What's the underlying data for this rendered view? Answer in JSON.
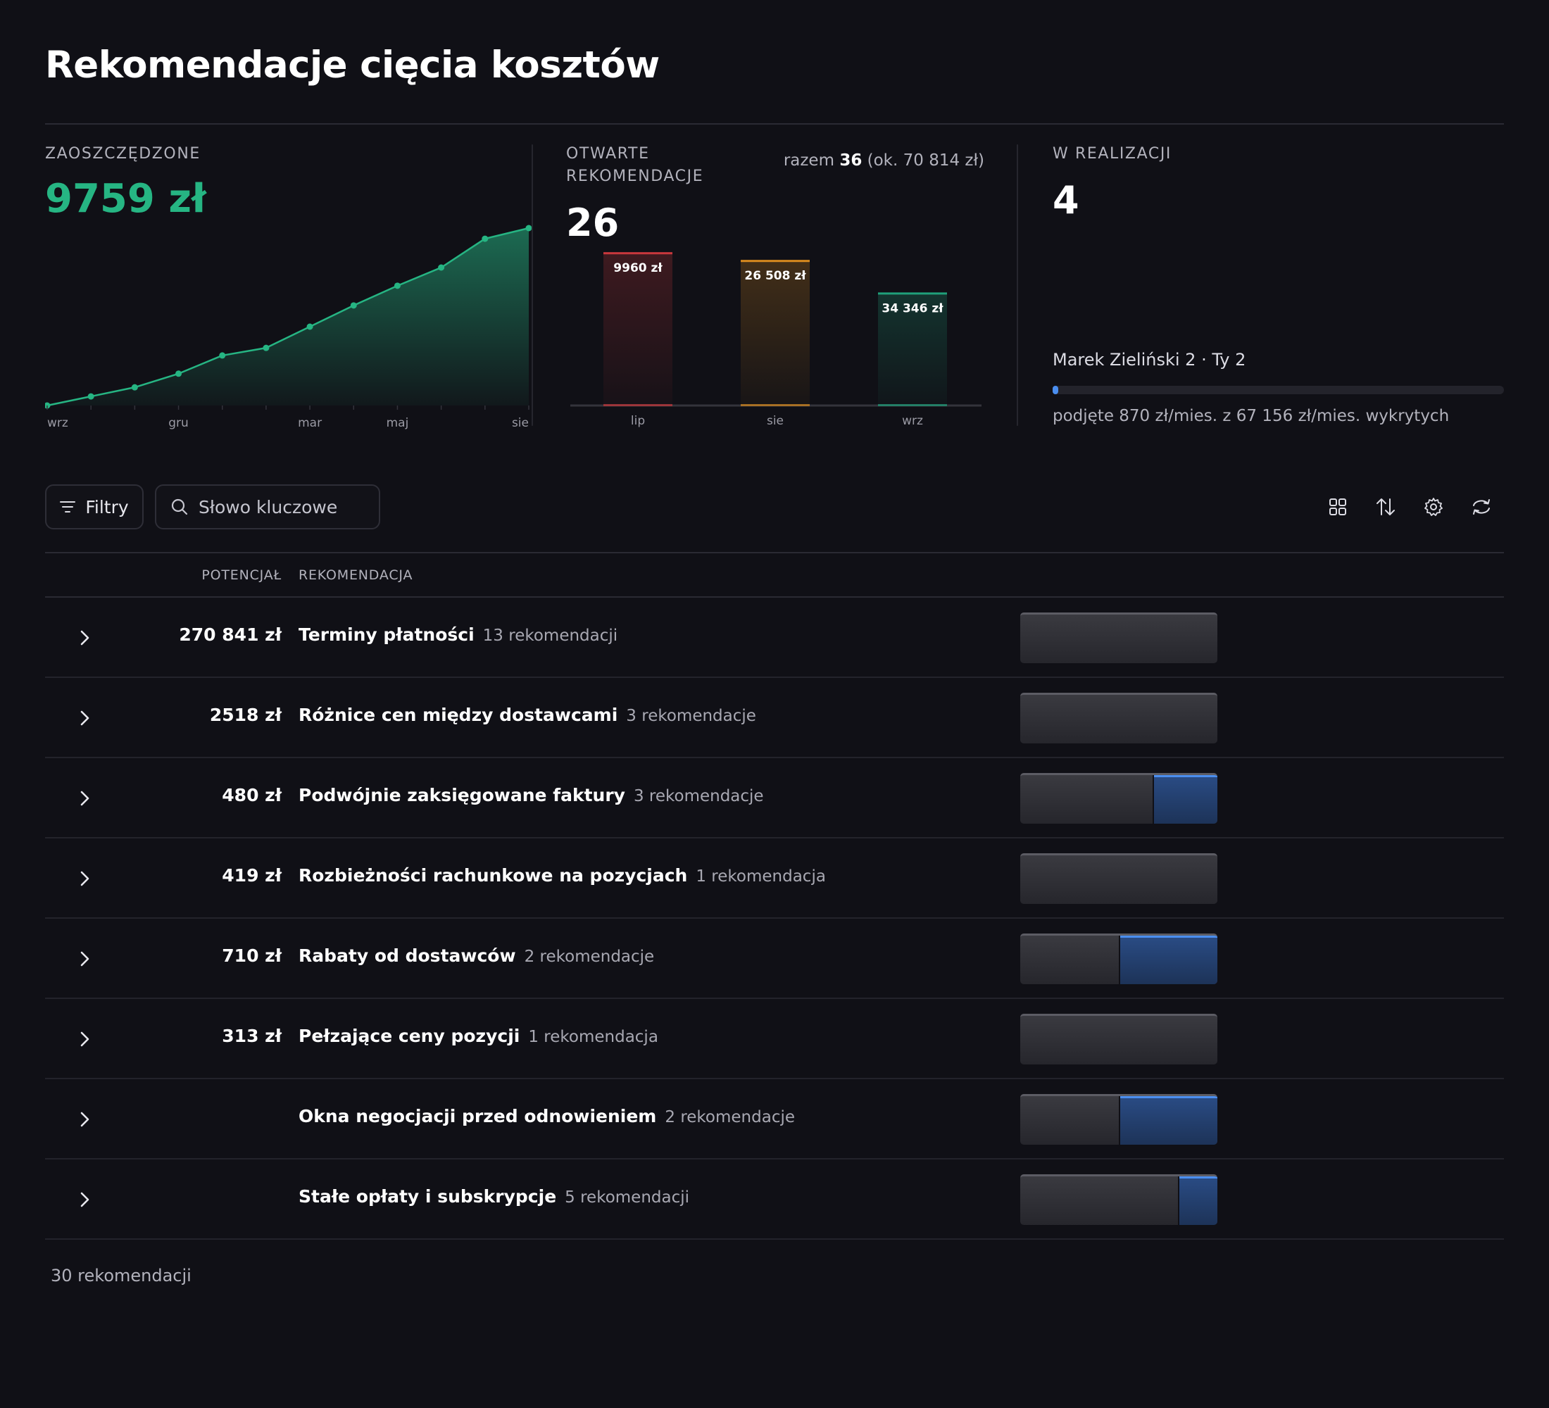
{
  "page": {
    "title": "Rekomendacje cięcia kosztów"
  },
  "kpi": {
    "saved": {
      "label": "ZAOSZCZĘDZONE",
      "value": "9759 zł",
      "color": "#26b583",
      "x_labels": [
        "wrz",
        "gru",
        "mar",
        "maj",
        "sie"
      ],
      "series_relative": [
        0.0,
        0.06,
        0.12,
        0.21,
        0.33,
        0.38,
        0.52,
        0.66,
        0.79,
        0.91,
        1.1,
        1.17
      ]
    },
    "open": {
      "label_line1": "OTWARTE",
      "label_line2": "REKOMENDACJE",
      "value": "26",
      "total_prefix": "razem",
      "total_count": "36",
      "total_suffix": "(ok. 70 814 zł)",
      "bars": [
        {
          "month": "lip",
          "label": "9960 zł",
          "value": 9960,
          "color": "#c8383c"
        },
        {
          "month": "sie",
          "label": "26 508 zł",
          "value": 26508,
          "color": "#d88a1e"
        },
        {
          "month": "wrz",
          "label": "34 346 zł",
          "value": 34346,
          "color": "#1fa07a"
        }
      ]
    },
    "in_progress": {
      "label": "W REALIZACJI",
      "value": "4",
      "person": "Marek Zieliński 2 · Ty 2",
      "progress_fraction": 0.013,
      "progress_text": "podjęte 870 zł/mies. z 67 156 zł/mies. wykrytych"
    }
  },
  "toolbar": {
    "filter_label": "Filtry",
    "search_placeholder": "Słowo kluczowe"
  },
  "table": {
    "headers": {
      "potential": "POTENCJAŁ",
      "recommendation": "REKOMENDACJA"
    },
    "rows": [
      {
        "amount": "270 841 zł",
        "name": "Terminy płatności",
        "count": "13 rekomendacji",
        "blue_fraction": 0
      },
      {
        "amount": "2518 zł",
        "name": "Różnice cen między dostawcami",
        "count": "3 rekomendacje",
        "blue_fraction": 0
      },
      {
        "amount": "480 zł",
        "name": "Podwójnie zaksięgowane faktury",
        "count": "3 rekomendacje",
        "blue_fraction": 0.33
      },
      {
        "amount": "419 zł",
        "name": "Rozbieżności rachunkowe na pozycjach",
        "count": "1 rekomendacja",
        "blue_fraction": 0
      },
      {
        "amount": "710 zł",
        "name": "Rabaty od dostawców",
        "count": "2 rekomendacje",
        "blue_fraction": 0.5
      },
      {
        "amount": "313 zł",
        "name": "Pełzające ceny pozycji",
        "count": "1 rekomendacja",
        "blue_fraction": 0
      },
      {
        "amount": "",
        "name": "Okna negocjacji przed odnowieniem",
        "count": "2 rekomendacje",
        "blue_fraction": 0.5
      },
      {
        "amount": "",
        "name": "Stałe opłaty i subskrypcje",
        "count": "5 rekomendacji",
        "blue_fraction": 0.2
      }
    ],
    "footer": "30 rekomendacji"
  }
}
